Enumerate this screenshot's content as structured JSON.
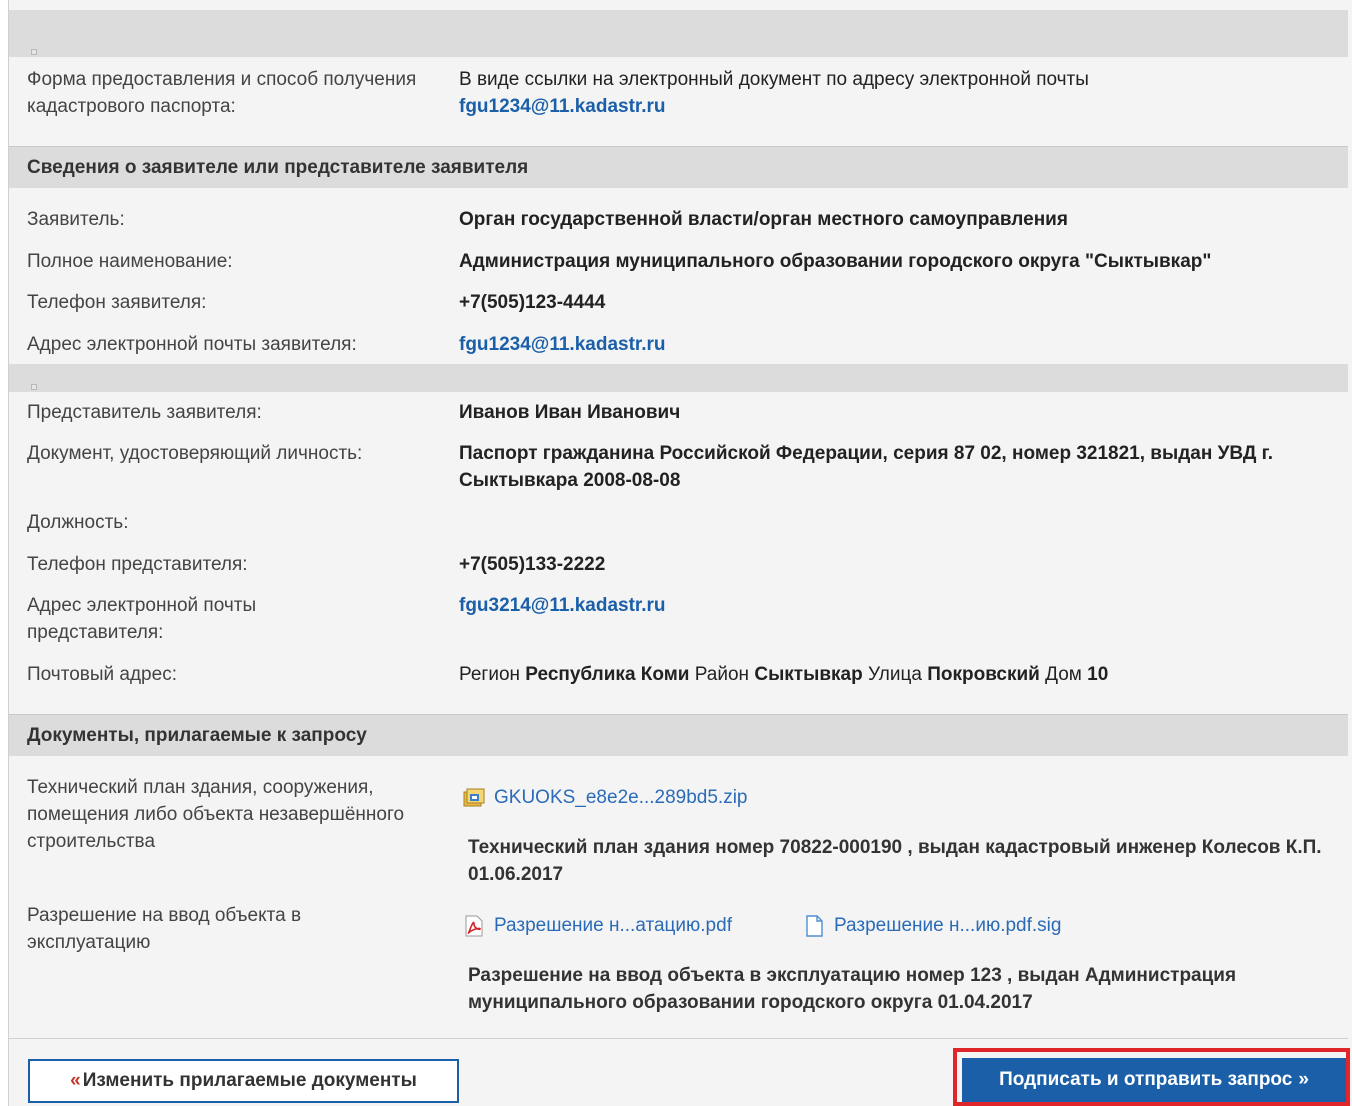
{
  "delivery": {
    "label": "Форма предоставления и способ получения кадастрового паспорта:",
    "value": "В виде ссылки на электронный документ по адресу электронной почты",
    "email": "fgu1234@11.kadastr.ru"
  },
  "applicant_section": {
    "title": "Сведения о заявителе или представителе заявителя",
    "rows": [
      {
        "label": "Заявитель:",
        "value": "Орган государственной власти/орган местного самоуправления"
      },
      {
        "label": "Полное наименование:",
        "value": "Администрация муниципального образовании городского округа \"Сыктывкар\""
      },
      {
        "label": "Телефон заявителя:",
        "value": "+7(505)123-4444"
      },
      {
        "label": "Адрес электронной почты заявителя:",
        "value": "fgu1234@11.kadastr.ru"
      }
    ]
  },
  "representative": {
    "rows": [
      {
        "label": "Представитель заявителя:",
        "value": "Иванов Иван Иванович"
      },
      {
        "label": "Документ, удостоверяющий личность:",
        "value": "Паспорт гражданина Российской Федерации, серия 87 02, номер 321821, выдан УВД г. Сыктывкара 2008-08-08"
      },
      {
        "label": "Должность:",
        "value": ""
      },
      {
        "label": "Телефон представителя:",
        "value": "+7(505)133-2222"
      },
      {
        "label": "Адрес электронной почты представителя:",
        "value": "fgu3214@11.kadastr.ru"
      }
    ],
    "postal": {
      "label": "Почтовый адрес:",
      "region_label": "Регион",
      "region": "Республика Коми",
      "district_label": "Район",
      "district": "Сыктывкар",
      "street_label": "Улица",
      "street": "Покровский",
      "house_label": "Дом",
      "house": "10"
    }
  },
  "documents_section": {
    "title": "Документы, прилагаемые к запросу",
    "items": [
      {
        "label": "Технический план здания, сооружения, помещения либо объекта незавершённого строительства",
        "files": [
          {
            "name": "GKUOKS_e8e2e...289bd5.zip",
            "icon": "zip-archive-icon"
          }
        ],
        "description": "Технический план здания номер 70822-000190 , выдан кадастровый инженер Колесов К.П. 01.06.2017"
      },
      {
        "label": "Разрешение на ввод объекта в эксплуатацию",
        "files": [
          {
            "name": "Разрешение н...атацию.pdf",
            "icon": "pdf-icon"
          },
          {
            "name": "Разрешение н...ию.pdf.sig",
            "icon": "file-icon"
          }
        ],
        "description": "Разрешение на ввод объекта в эксплуатацию номер 123 , выдан Администрация муниципального образовании городского округа 01.04.2017"
      }
    ]
  },
  "buttons": {
    "back_arrow": "«",
    "back": "Изменить прилагаемые документы",
    "submit": "Подписать и отправить запрос",
    "submit_arrow": "»"
  },
  "colors": {
    "accent": "#1a5fa8",
    "highlight": "#e0262b",
    "section_bg": "#dcdcdc"
  }
}
